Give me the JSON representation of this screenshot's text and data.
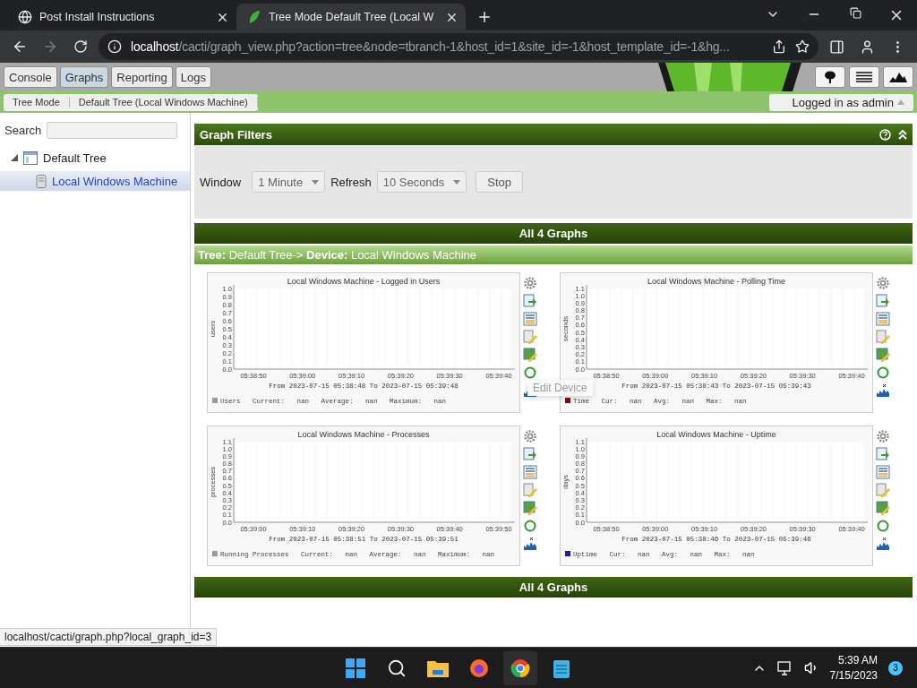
{
  "browser": {
    "tabs": [
      {
        "title": "Post Install Instructions",
        "selected": false
      },
      {
        "title": "Tree Mode Default Tree (Local W",
        "selected": true
      }
    ],
    "url": {
      "host": "localhost",
      "path": "/cacti/graph_view.php?action=tree&node=tbranch-1&host_id=1&site_id=-1&host_template_id=-1&hg..."
    }
  },
  "nav_tabs": [
    {
      "label": "Console",
      "selected": false
    },
    {
      "label": "Graphs",
      "selected": true
    },
    {
      "label": "Reporting",
      "selected": false
    },
    {
      "label": "Logs",
      "selected": false
    }
  ],
  "breadcrumbs": [
    "Tree Mode",
    "Default Tree (Local Windows Machine)"
  ],
  "user": "Logged in as admin",
  "sidebar": {
    "search_label": "Search",
    "tree": [
      {
        "label": "Default Tree",
        "expanded": true,
        "selected": false,
        "children": [
          {
            "label": "Local Windows Machine",
            "selected": true
          }
        ]
      }
    ]
  },
  "filters": {
    "title": "Graph Filters",
    "window_label": "Window",
    "window_value": "1 Minute",
    "refresh_label": "Refresh",
    "refresh_value": "10 Seconds",
    "button": "Stop"
  },
  "summary_top": "All 4 Graphs",
  "path": "**Tree:** Default Tree-> **Device:** Local Windows Machine",
  "graphs": [
    {
      "title": "Local Windows Machine - Logged in Users",
      "ylabel": "users",
      "yticks": [
        "1.0",
        "0.9",
        "0.8",
        "0.7",
        "0.6",
        "0.5",
        "0.4",
        "0.3",
        "0.2",
        "0.1",
        "0.0"
      ],
      "xticks": [
        "05:38:50",
        "05:39:00",
        "05:39:10",
        "05:39:20",
        "05:39:30",
        "05:39:40"
      ],
      "range": "From 2023-07-15 05:38:48 To 2023-07-15 05:39:48",
      "legend": "Users   Current:   nan   Average:   nan   Maximum:   nan",
      "color": "#9a9a9a"
    },
    {
      "title": "Local Windows Machine - Polling Time",
      "ylabel": "seconds",
      "yticks": [
        "1.1",
        "1.0",
        "0.9",
        "0.8",
        "0.7",
        "0.6",
        "0.5",
        "0.4",
        "0.3",
        "0.2",
        "0.1",
        "0.0"
      ],
      "xticks": [
        "05:38:50",
        "05:39:00",
        "05:39:10",
        "05:39:20",
        "05:39:30",
        "05:39:40"
      ],
      "range": "From 2023-07-15 05:38:43 To 2023-07-15 05:39:43",
      "legend": "Time   Cur:   nan   Avg:   nan   Max:   nan",
      "color": "#7a1010"
    },
    {
      "title": "Local Windows Machine - Processes",
      "ylabel": "processes",
      "yticks": [
        "1.1",
        "1.0",
        "0.9",
        "0.8",
        "0.7",
        "0.6",
        "0.5",
        "0.4",
        "0.3",
        "0.2",
        "0.1",
        "0.0"
      ],
      "xticks": [
        "05:39:00",
        "05:39:10",
        "05:39:20",
        "05:39:30",
        "05:39:40",
        "05:39:50"
      ],
      "range": "From 2023-07-15 05:38:51 To 2023-07-15 05:39:51",
      "legend": "Running Processes   Current:   nan   Average:   nan   Maximum:   nan",
      "color": "#9a9a9a"
    },
    {
      "title": "Local Windows Machine - Uptime",
      "ylabel": "days",
      "yticks": [
        "1.1",
        "1.0",
        "0.9",
        "0.8",
        "0.7",
        "0.6",
        "0.5",
        "0.4",
        "0.3",
        "0.2",
        "0.1",
        "0.0"
      ],
      "xticks": [
        "05:38:50",
        "05:39:00",
        "05:39:10",
        "05:39:20",
        "05:39:30",
        "05:39:40"
      ],
      "range": "From 2023-07-15 05:38:46 To 2023-07-15 05:39:46",
      "legend": "Uptime   Cur:   nan   Avg:   nan   Max:   nan",
      "color": "#1a1a9a"
    }
  ],
  "tooltip": "Edit Device",
  "summary_bottom": "All 4 Graphs",
  "status_url": "localhost/cacti/graph.php?local_graph_id=3",
  "taskbar": {
    "time": "5:39 AM",
    "date": "7/15/2023",
    "badge": "3"
  }
}
